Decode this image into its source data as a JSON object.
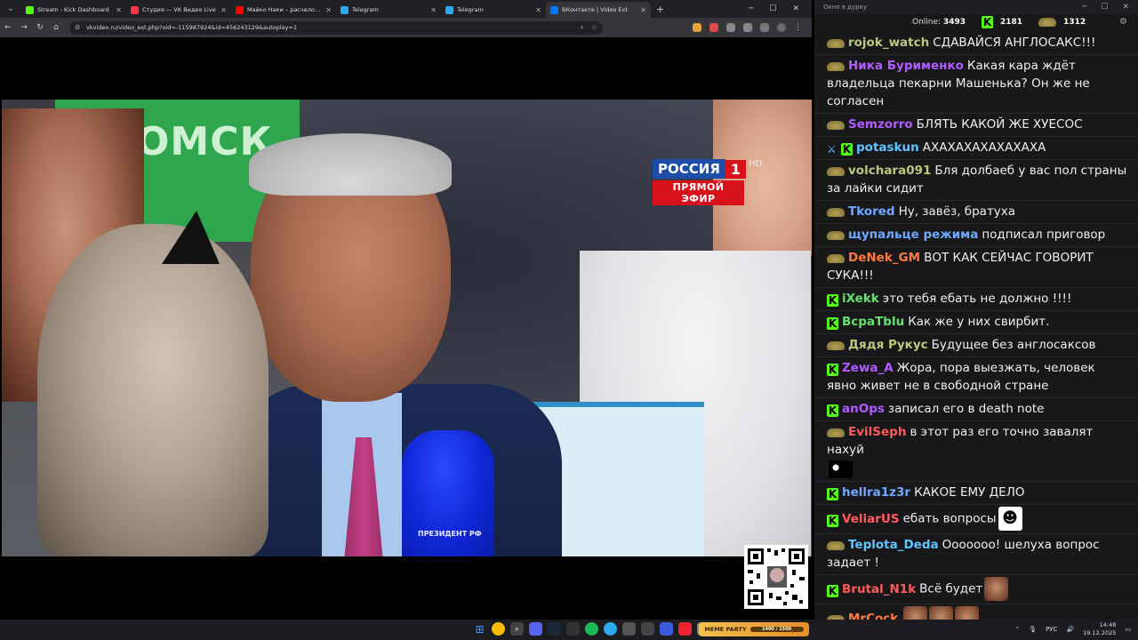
{
  "browser": {
    "tabs": [
      {
        "title": "Stream - Kick Dashboard",
        "color": "#53fc18",
        "active": false
      },
      {
        "title": "Студия — VK Видео Live",
        "color": "#ff3347",
        "active": false
      },
      {
        "title": "Майко Наки – расчеловечиваю",
        "color": "#ff0000",
        "active": false
      },
      {
        "title": "Telegram",
        "color": "#2aabee",
        "active": false
      },
      {
        "title": "Telegram",
        "color": "#2aabee",
        "active": false
      },
      {
        "title": "ВКонтакте | Video Ext",
        "color": "#0077ff",
        "active": true
      }
    ],
    "url": "vkvideo.ru/video_ext.php?oid=-115987924&id=456243129&autoplay=1"
  },
  "video": {
    "sign_text": "ТОМСК",
    "channel_name": "РОССИЯ",
    "channel_number": "1",
    "hd": "HD",
    "live_label": "ПРЯМОЙ ЭФИР",
    "mic_label": "ПРЕЗИДЕНТ РФ"
  },
  "chat": {
    "window_title": "Окно в дурку",
    "online_label": "Online:",
    "online_count": "3493",
    "kick_count": "2181",
    "sub_count": "1312",
    "messages": [
      {
        "user": "rojok_watch",
        "color": "#b9c97a",
        "text": "СДАВАЙСЯ АНГЛОСАКС!!!",
        "badges": [
          "sub"
        ]
      },
      {
        "user": "Ника Бурименко",
        "color": "#b25cff",
        "text": "Какая кара ждёт владельца пекарни Машенька? Он же не согласен",
        "badges": [
          "sub"
        ]
      },
      {
        "user": "Semzorro",
        "color": "#b25cff",
        "text": "БЛЯТЬ КАКОЙ ЖЕ ХУЕСОС",
        "badges": [
          "sub"
        ]
      },
      {
        "user": "potaskun",
        "color": "#5fc4ff",
        "text": "АХАХАХАХАХАХАХА",
        "badges": [
          "sword",
          "kick"
        ]
      },
      {
        "user": "volchara091",
        "color": "#b9c97a",
        "text": "Бля долбаеб у вас пол страны за лайки сидит",
        "badges": [
          "sub"
        ]
      },
      {
        "user": "Tkored",
        "color": "#6ea9ff",
        "text": "Ну, завёз, братуха",
        "badges": [
          "sub"
        ]
      },
      {
        "user": "щупальце режима",
        "color": "#6ea9ff",
        "text": "подписал приговор",
        "badges": [
          "sub"
        ]
      },
      {
        "user": "DeNek_GM",
        "color": "#ff7a3d",
        "text": "ВОТ КАК СЕЙЧАС ГОВОРИТ СУКА!!!",
        "badges": [
          "sub"
        ]
      },
      {
        "user": "iXekk",
        "color": "#66e06c",
        "text": "это тебя ебать не должно !!!!",
        "badges": [
          "kick"
        ]
      },
      {
        "user": "BcpaTblu",
        "color": "#66e06c",
        "text": "Как же у них свирбит.",
        "badges": [
          "kick"
        ]
      },
      {
        "user": "Дядя Рукус",
        "color": "#b9c97a",
        "text": "Будущее без англосаксов",
        "badges": [
          "sub"
        ]
      },
      {
        "user": "Zewa_A",
        "color": "#b25cff",
        "text": "Жора, пора выезжать, человек явно живет не в свободной стране",
        "badges": [
          "kick"
        ]
      },
      {
        "user": "anOps",
        "color": "#b25cff",
        "text": "записал его в death note",
        "badges": [
          "kick"
        ]
      },
      {
        "user": "EvilSeph",
        "color": "#ff5a5a",
        "text": "в этот раз его точно завалят нахуй",
        "badges": [
          "sub"
        ],
        "emote_below": "cat"
      },
      {
        "user": "hellra1z3r",
        "color": "#6ea9ff",
        "text": "КАКОЕ ЕМУ ДЕЛО",
        "badges": [
          "kick"
        ]
      },
      {
        "user": "VeliarUS",
        "color": "#ff5a5a",
        "text": "ебать вопросы",
        "badges": [
          "kick"
        ],
        "emotes": [
          "smile"
        ]
      },
      {
        "user": "Teplota_Deda",
        "color": "#5fc4ff",
        "text": "Ооооооо! шелуха вопрос задает !",
        "badges": [
          "sub"
        ]
      },
      {
        "user": "Brutal_N1k",
        "color": "#ff5a5a",
        "text": "Всё будет",
        "badges": [
          "kick"
        ],
        "emotes": [
          "face"
        ]
      },
      {
        "user": "MrCock",
        "color": "#ff7a3d",
        "text": "",
        "badges": [
          "sub"
        ],
        "emotes": [
          "face",
          "face",
          "face"
        ]
      }
    ]
  },
  "taskbar": {
    "meme_label": "MEME PARTY",
    "meme_progress": "1400 / 1500",
    "lang": "РУС",
    "time": "14:48",
    "date": "19.12.2025"
  }
}
